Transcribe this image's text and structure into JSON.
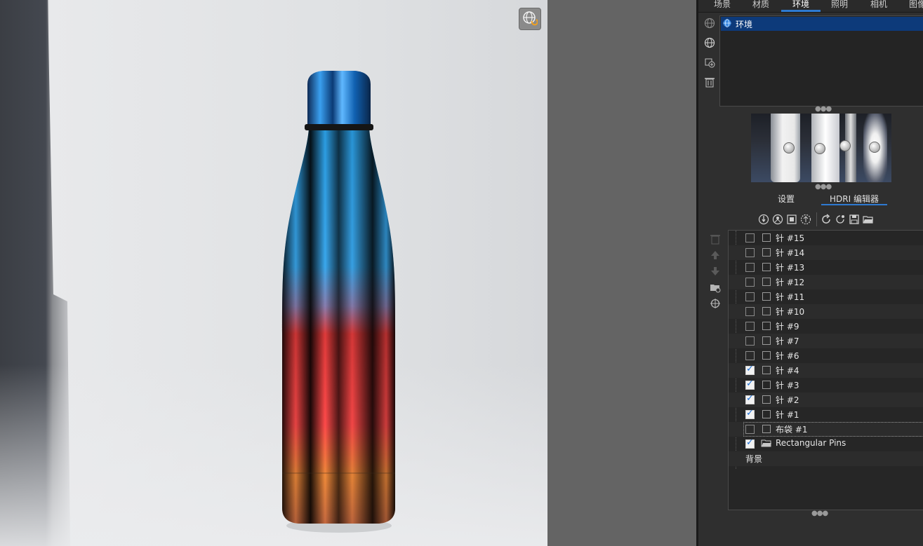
{
  "viewport": {
    "env_refresh_icon": "globe-refresh-icon"
  },
  "tabs": [
    {
      "label": "场景",
      "active": false
    },
    {
      "label": "材质",
      "active": false
    },
    {
      "label": "环境",
      "active": true
    },
    {
      "label": "照明",
      "active": false
    },
    {
      "label": "相机",
      "active": false
    },
    {
      "label": "图像",
      "active": false
    }
  ],
  "environment_list": {
    "selected_item": "环境"
  },
  "sub_tabs": [
    {
      "label": "设置",
      "active": false
    },
    {
      "label": "HDRI 编辑器",
      "active": true
    }
  ],
  "tree": [
    {
      "label": "针 #15",
      "checked": false,
      "type": "pin"
    },
    {
      "label": "针 #14",
      "checked": false,
      "type": "pin"
    },
    {
      "label": "针 #13",
      "checked": false,
      "type": "pin"
    },
    {
      "label": "针 #12",
      "checked": false,
      "type": "pin"
    },
    {
      "label": "针 #11",
      "checked": false,
      "type": "pin"
    },
    {
      "label": "针 #10",
      "checked": false,
      "type": "pin"
    },
    {
      "label": "针 #9",
      "checked": false,
      "type": "pin"
    },
    {
      "label": "针 #7",
      "checked": false,
      "type": "pin"
    },
    {
      "label": "针 #6",
      "checked": false,
      "type": "pin"
    },
    {
      "label": "针 #4",
      "checked": true,
      "type": "pin"
    },
    {
      "label": "针 #3",
      "checked": true,
      "type": "pin"
    },
    {
      "label": "针 #2",
      "checked": true,
      "type": "pin"
    },
    {
      "label": "针 #1",
      "checked": true,
      "type": "pin"
    },
    {
      "label": "布袋 #1",
      "checked": false,
      "type": "pin"
    },
    {
      "label": "Rectangular Pins",
      "checked": true,
      "type": "folder"
    },
    {
      "label": "背景",
      "checked": null,
      "type": "background"
    }
  ],
  "colors": {
    "accent": "#2e7ad1",
    "selection": "#0d3a7a",
    "checkbox_check": "#1c6fd6"
  }
}
